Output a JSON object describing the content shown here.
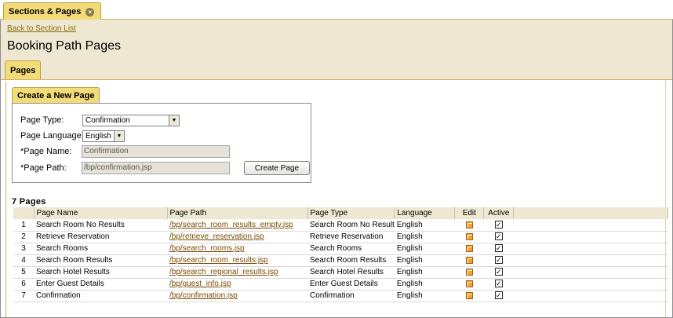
{
  "tab": {
    "label": "Sections & Pages",
    "close_glyph": "×"
  },
  "header": {
    "back_link": "Back to Section List",
    "title": "Booking Path Pages",
    "tab_label": "Pages"
  },
  "create": {
    "tab_label": "Create a New Page",
    "page_type_label": "Page Type:",
    "page_type_value": "Confirmation",
    "page_language_label": "Page Language:",
    "page_language_value": "English",
    "page_name_label": "*Page Name:",
    "page_name_value": "Confirmation",
    "page_path_label": "*Page Path:",
    "page_path_value": "/bp/confirmation.jsp",
    "button_label": "Create Page",
    "arrow_glyph": "▼"
  },
  "pages": {
    "count_label": "7 Pages",
    "columns": [
      "Page Name",
      "Page Path",
      "Page Type",
      "Language",
      "Edit",
      "Active"
    ],
    "check_glyph": "✓",
    "rows": [
      {
        "num": "1",
        "name": "Search Room No Results",
        "path": "/bp/search_room_results_empty.jsp",
        "type": "Search Room No Result",
        "language": "English"
      },
      {
        "num": "2",
        "name": "Retrieve Reservation",
        "path": "/bp/retrieve_reservation.jsp",
        "type": "Retrieve Reservation",
        "language": "English"
      },
      {
        "num": "3",
        "name": "Search Rooms",
        "path": "/bp/search_rooms.jsp",
        "type": "Search Rooms",
        "language": "English"
      },
      {
        "num": "4",
        "name": "Search Room Results",
        "path": "/bp/search_room_results.jsp",
        "type": "Search Room Results",
        "language": "English"
      },
      {
        "num": "5",
        "name": "Search Hotel Results",
        "path": "/bp/search_regional_results.jsp",
        "type": "Search Hotel Results",
        "language": "English"
      },
      {
        "num": "6",
        "name": "Enter Guest Details",
        "path": "/bp/guest_info.jsp",
        "type": "Enter Guest Details",
        "language": "English"
      },
      {
        "num": "7",
        "name": "Confirmation",
        "path": "/bp/confirmation.jsp",
        "type": "Confirmation",
        "language": "English"
      }
    ]
  },
  "colors": {
    "accent_tab": "#f3db7a",
    "header_bg": "#eee8d2",
    "link": "#7a4a00"
  }
}
